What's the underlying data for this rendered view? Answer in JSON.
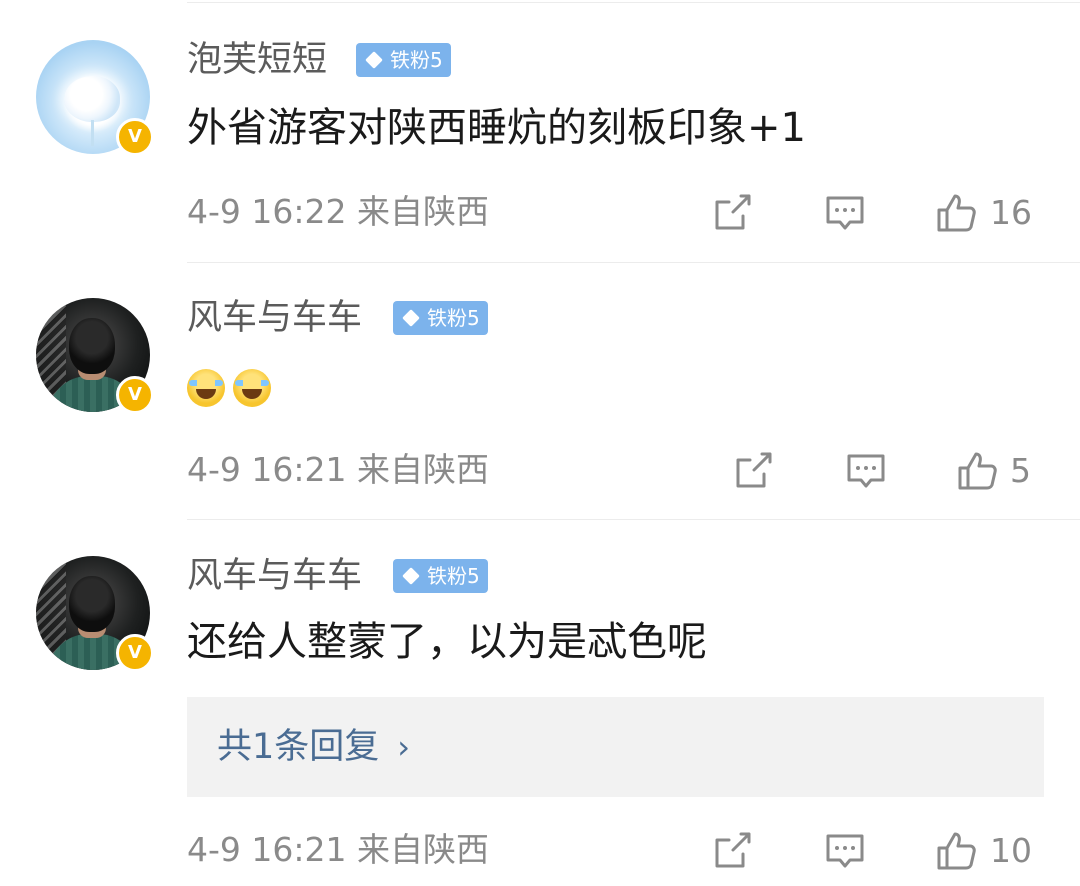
{
  "comments": [
    {
      "username": "泡芙短短",
      "fan_badge": "铁粉5",
      "content": "外省游客对陕西睡炕的刻板印象+1",
      "time": "4-9 16:22",
      "location": "来自陕西",
      "likes": "16",
      "avatar_icon": "flower-avatar",
      "verified_badge": "V"
    },
    {
      "username": "风车与车车",
      "fan_badge": "铁粉5",
      "content_emojis": [
        "laugh-cry-emoji",
        "laugh-cry-emoji"
      ],
      "time": "4-9 16:21",
      "location": "来自陕西",
      "likes": "5",
      "avatar_icon": "person-avatar",
      "verified_badge": "V"
    },
    {
      "username": "风车与车车",
      "fan_badge": "铁粉5",
      "content": "还给人整蒙了，以为是忒色呢",
      "reply_summary": "共1条回复",
      "reply_chevron": "›",
      "time": "4-9 16:21",
      "location": "来自陕西",
      "likes": "10",
      "avatar_icon": "person-avatar",
      "verified_badge": "V"
    }
  ],
  "colors": {
    "fan_badge_bg": "#7cb3ec",
    "verified_badge_bg": "#f5b400",
    "reply_link": "#4a6c93",
    "meta_text": "#8a8a8a"
  },
  "icons": {
    "share": "share-icon",
    "comment": "comment-icon",
    "like": "thumbs-up-icon"
  }
}
